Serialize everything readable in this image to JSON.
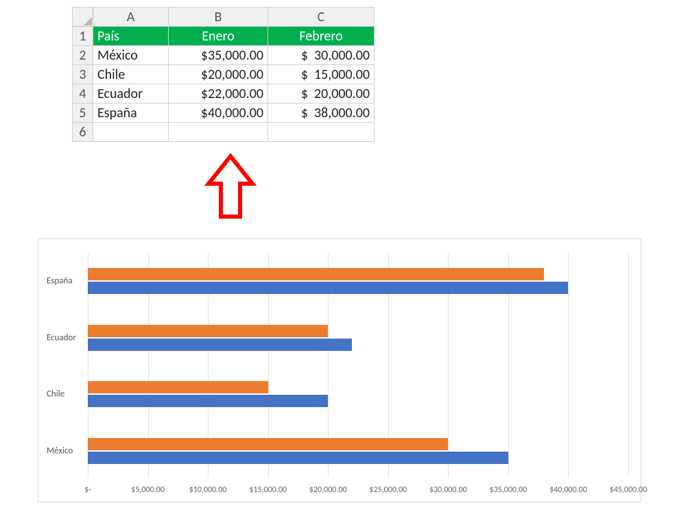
{
  "sheet": {
    "col_headers": [
      "A",
      "B",
      "C"
    ],
    "row_headers": [
      "1",
      "2",
      "3",
      "4",
      "5",
      "6"
    ],
    "header_row": {
      "pais": "País",
      "enero": "Enero",
      "febrero": "Febrero"
    },
    "rows": [
      {
        "pais": "México",
        "enero": "$35,000.00",
        "febrero": "$  30,000.00"
      },
      {
        "pais": "Chile",
        "enero": "$20,000.00",
        "febrero": "$  15,000.00"
      },
      {
        "pais": "Ecuador",
        "enero": "$22,000.00",
        "febrero": "$  20,000.00"
      },
      {
        "pais": "España",
        "enero": "$40,000.00",
        "febrero": "$  38,000.00"
      }
    ]
  },
  "chart_data": {
    "type": "bar",
    "orientation": "horizontal",
    "categories": [
      "México",
      "Chile",
      "Ecuador",
      "España"
    ],
    "category_order_on_axis": [
      "España",
      "Ecuador",
      "Chile",
      "México"
    ],
    "series": [
      {
        "name": "Enero",
        "color": "#4472c4",
        "values": [
          35000,
          20000,
          22000,
          40000
        ]
      },
      {
        "name": "Febrero",
        "color": "#ed7d31",
        "values": [
          30000,
          15000,
          20000,
          38000
        ]
      }
    ],
    "xlim": [
      0,
      45000
    ],
    "xticks": [
      0,
      5000,
      10000,
      15000,
      20000,
      25000,
      30000,
      35000,
      40000,
      45000
    ],
    "xtick_labels": [
      "$-",
      "$5,000.00",
      "$10,000.00",
      "$15,000.00",
      "$20,000.00",
      "$25,000.00",
      "$30,000.00",
      "$35,000.00",
      "$40,000.00",
      "$45,000.00"
    ],
    "title": "",
    "xlabel": "",
    "ylabel": ""
  },
  "colors": {
    "header_green": "#00b050",
    "series_blue": "#4472c4",
    "series_orange": "#ed7d31",
    "arrow_red": "#ff0000"
  }
}
